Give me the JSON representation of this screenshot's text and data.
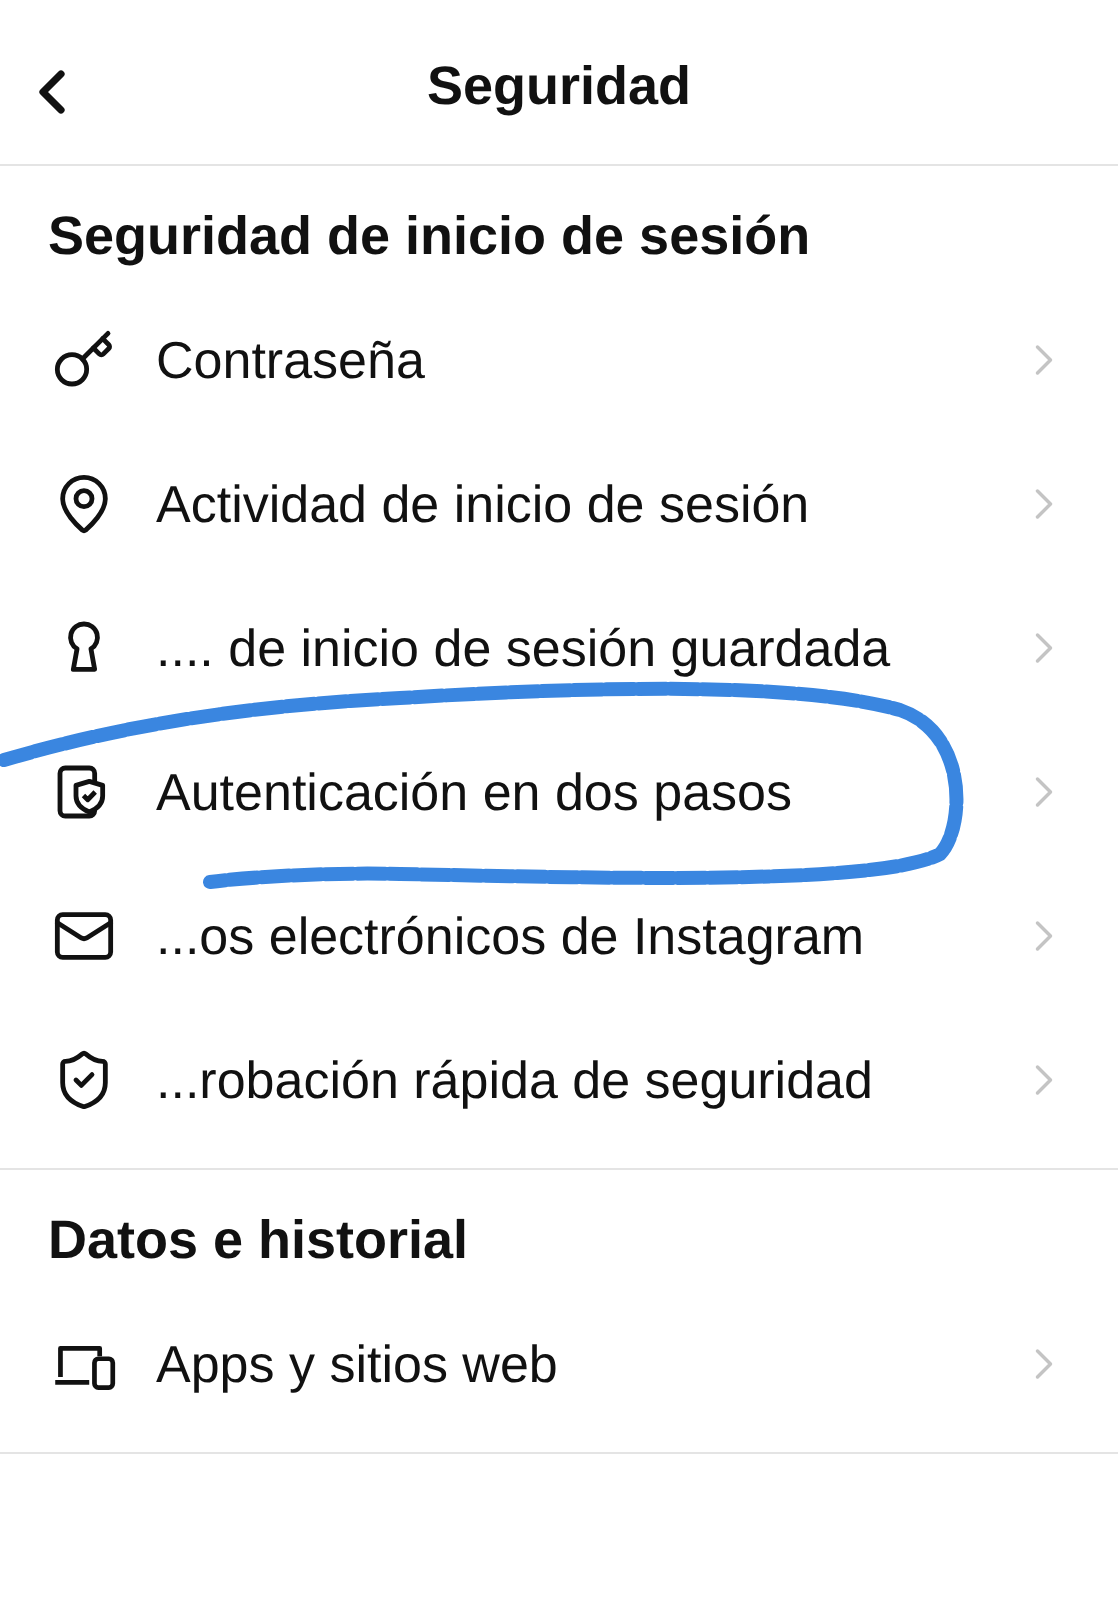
{
  "header": {
    "title": "Seguridad"
  },
  "sections": [
    {
      "heading": "Seguridad de inicio de sesión",
      "items": [
        {
          "label": "Contraseña"
        },
        {
          "label": "Actividad de inicio de sesión"
        },
        {
          "label": ".... de inicio de sesión guardada"
        },
        {
          "label": "Autenticación en dos pasos"
        },
        {
          "label": "...os electrónicos de Instagram"
        },
        {
          "label": "...robación rápida de seguridad"
        }
      ]
    },
    {
      "heading": "Datos e historial",
      "items": [
        {
          "label": "Apps y sitios web"
        }
      ]
    }
  ]
}
